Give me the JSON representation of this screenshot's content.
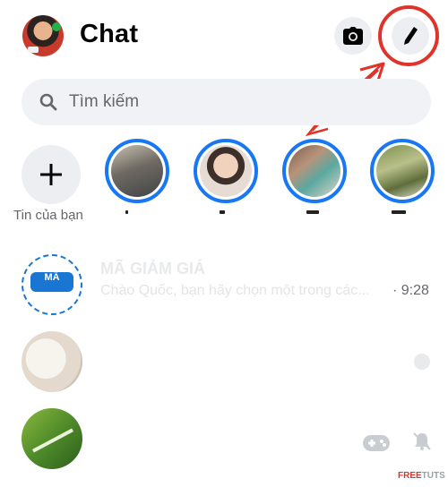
{
  "header": {
    "title": "Chat",
    "icons": {
      "camera": "camera-icon",
      "compose": "pencil-icon"
    }
  },
  "search": {
    "placeholder": "Tìm kiếm",
    "icon": "search-icon"
  },
  "stories": {
    "add_label": "Tin của bạn"
  },
  "chats": [
    {
      "name": "MÃ GIẢM GIÁ",
      "preview": "Chào Quốc, bạn hãy chọn một trong các...",
      "time": "· 9:28",
      "avatar_text": "MÃ"
    }
  ],
  "watermark": {
    "part1": "FREE",
    "part2": "TUTS"
  },
  "colors": {
    "accent": "#1877f2",
    "annotation": "#e0342b",
    "surface": "#f0f2f5",
    "secondary_text": "#65676b"
  }
}
